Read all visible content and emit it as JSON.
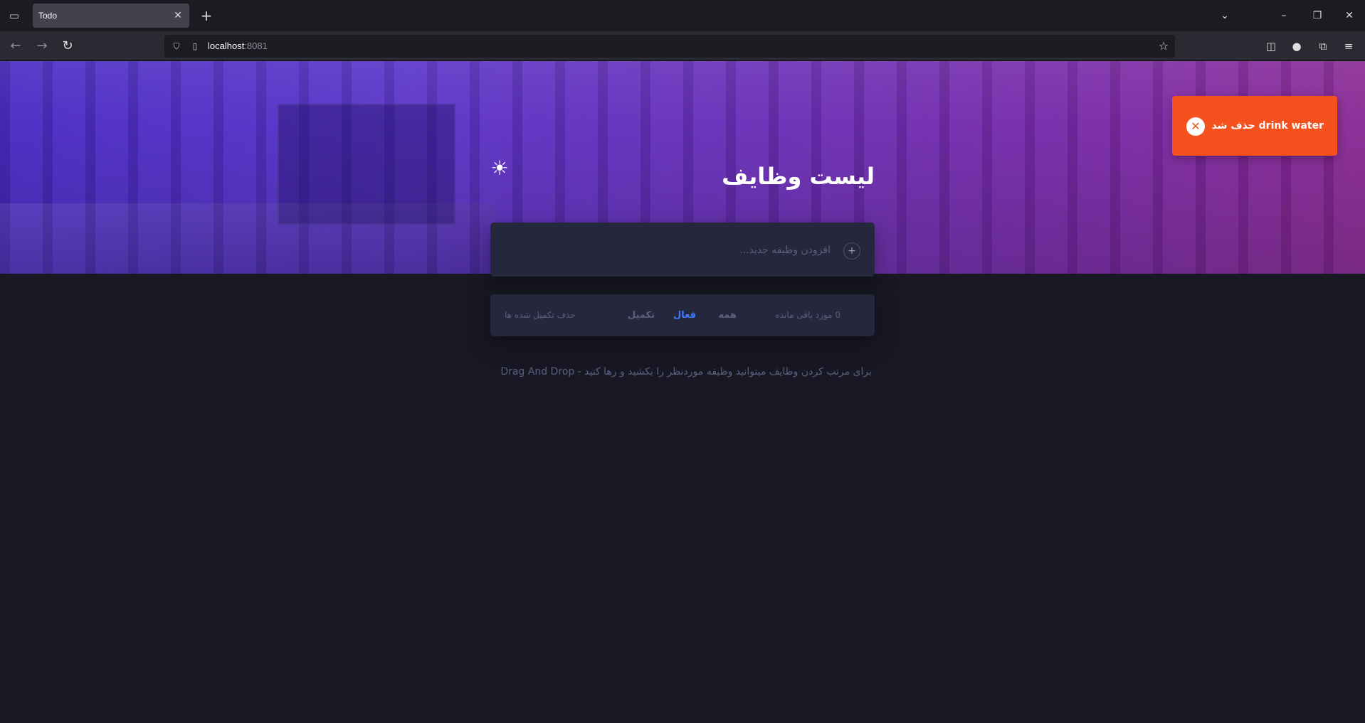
{
  "browser": {
    "tab_title": "Todo",
    "url_host": "localhost",
    "url_port": ":8081"
  },
  "app": {
    "title": "لیست وظایف",
    "new_todo_placeholder": "افزودن وظیفه جدید...",
    "items_left": "0 مورد باقی مانده",
    "filters": {
      "all": "همه",
      "active": "فعال",
      "completed": "تکمیل"
    },
    "active_filter": "active",
    "clear_completed": "حذف تکمیل شده ها",
    "hint": "برای مرتب کردن وظایف میتوانید وظیفه موردنظر را بکشید و رها کنید - Drag And Drop"
  },
  "toast": {
    "message": "drink water حذف شد",
    "type": "error",
    "color": "#f4511e"
  },
  "theme": {
    "accent": "#3a7bfd",
    "card_bg": "#25273c",
    "page_bg": "#181824"
  }
}
